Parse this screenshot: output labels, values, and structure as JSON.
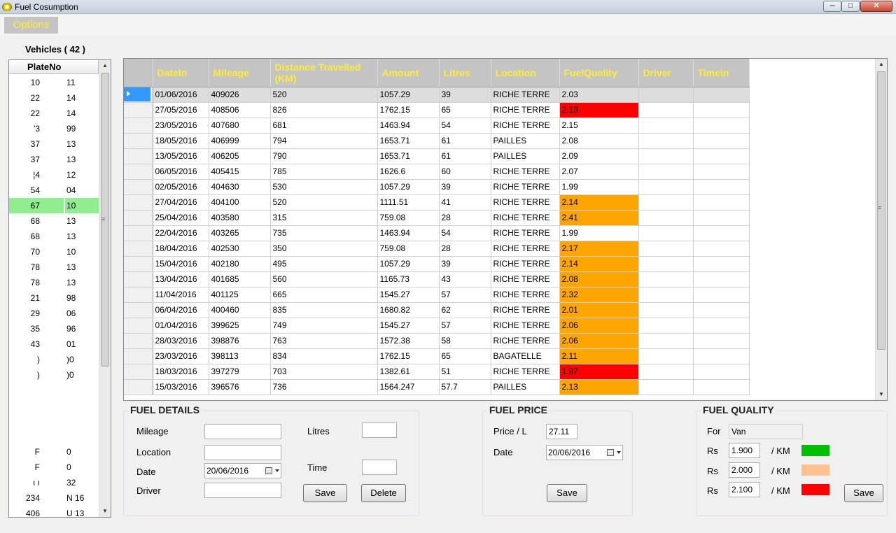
{
  "window": {
    "title": "Fuel Cosumption"
  },
  "menu": {
    "options_label": "Options"
  },
  "vehicles": {
    "title": "Vehicles ( 42 )",
    "column": "PlateNo",
    "rows_top": [
      {
        "a": "10",
        "b": "11"
      },
      {
        "a": "22",
        "b": "14"
      },
      {
        "a": "22",
        "b": "14"
      },
      {
        "a": "3'",
        "b": "99"
      },
      {
        "a": "37",
        "b": "13"
      },
      {
        "a": "37",
        "b": "13"
      },
      {
        "a": "4¦",
        "b": "12"
      },
      {
        "a": "54",
        "b": "04"
      },
      {
        "a": "67",
        "b": "10"
      },
      {
        "a": "68",
        "b": "13"
      },
      {
        "a": "68",
        "b": "13"
      },
      {
        "a": "70",
        "b": "10"
      },
      {
        "a": "78",
        "b": "13"
      },
      {
        "a": "78",
        "b": "13"
      },
      {
        "a": "21",
        "b": "98"
      },
      {
        "a": "29",
        "b": "06"
      },
      {
        "a": "35",
        "b": "96"
      },
      {
        "a": "43",
        "b": "01"
      },
      {
        "a": "(",
        "b": ")0"
      },
      {
        "a": "(",
        "b": ")0"
      }
    ],
    "rows_bottom": [
      {
        "a": "F",
        "b": "0"
      },
      {
        "a": "F",
        "b": "0"
      },
      {
        "a": "ı ı",
        "b": "32"
      },
      {
        "a": "234",
        "b": "N 16"
      },
      {
        "a": "406",
        "b": "U 13"
      }
    ],
    "selected_index": 8
  },
  "grid": {
    "columns": [
      "DateIn",
      "Mileage",
      "Distance Travelled (KM)",
      "Amount",
      "Litres",
      "Location",
      "FuelQuality",
      "Driver",
      "TimeIn"
    ],
    "rows": [
      {
        "date": "01/06/2016",
        "mileage": "409026",
        "distance": "520",
        "amount": "1057.29",
        "litres": "39",
        "location": "RICHE TERRE",
        "quality": "2.03",
        "q": ""
      },
      {
        "date": "27/05/2016",
        "mileage": "408506",
        "distance": "826",
        "amount": "1762.15",
        "litres": "65",
        "location": "RICHE TERRE",
        "quality": "2.13",
        "q": "red"
      },
      {
        "date": "23/05/2016",
        "mileage": "407680",
        "distance": "681",
        "amount": "1463.94",
        "litres": "54",
        "location": "RICHE TERRE",
        "quality": "2.15",
        "q": ""
      },
      {
        "date": "18/05/2016",
        "mileage": "406999",
        "distance": "794",
        "amount": "1653.71",
        "litres": "61",
        "location": "PAILLES",
        "quality": "2.08",
        "q": ""
      },
      {
        "date": "13/05/2016",
        "mileage": "406205",
        "distance": "790",
        "amount": "1653.71",
        "litres": "61",
        "location": "PAILLES",
        "quality": "2.09",
        "q": ""
      },
      {
        "date": "06/05/2016",
        "mileage": "405415",
        "distance": "785",
        "amount": "1626.6",
        "litres": "60",
        "location": "RICHE TERRE",
        "quality": "2.07",
        "q": ""
      },
      {
        "date": "02/05/2016",
        "mileage": "404630",
        "distance": "530",
        "amount": "1057.29",
        "litres": "39",
        "location": "RICHE TERRE",
        "quality": "1.99",
        "q": ""
      },
      {
        "date": "27/04/2016",
        "mileage": "404100",
        "distance": "520",
        "amount": "1111.51",
        "litres": "41",
        "location": "RICHE TERRE",
        "quality": "2.14",
        "q": "orange"
      },
      {
        "date": "25/04/2016",
        "mileage": "403580",
        "distance": "315",
        "amount": "759.08",
        "litres": "28",
        "location": "RICHE TERRE",
        "quality": "2.41",
        "q": "orange"
      },
      {
        "date": "22/04/2016",
        "mileage": "403265",
        "distance": "735",
        "amount": "1463.94",
        "litres": "54",
        "location": "RICHE TERRE",
        "quality": "1.99",
        "q": ""
      },
      {
        "date": "18/04/2016",
        "mileage": "402530",
        "distance": "350",
        "amount": "759.08",
        "litres": "28",
        "location": "RICHE TERRE",
        "quality": "2.17",
        "q": "orange"
      },
      {
        "date": "15/04/2016",
        "mileage": "402180",
        "distance": "495",
        "amount": "1057.29",
        "litres": "39",
        "location": "RICHE TERRE",
        "quality": "2.14",
        "q": "orange"
      },
      {
        "date": "13/04/2016",
        "mileage": "401685",
        "distance": "560",
        "amount": "1165.73",
        "litres": "43",
        "location": "RICHE TERRE",
        "quality": "2.08",
        "q": "orange"
      },
      {
        "date": "11/04/2016",
        "mileage": "401125",
        "distance": "665",
        "amount": "1545.27",
        "litres": "57",
        "location": "RICHE TERRE",
        "quality": "2.32",
        "q": "orange"
      },
      {
        "date": "06/04/2016",
        "mileage": "400460",
        "distance": "835",
        "amount": "1680.82",
        "litres": "62",
        "location": "RICHE TERRE",
        "quality": "2.01",
        "q": "orange"
      },
      {
        "date": "01/04/2016",
        "mileage": "399625",
        "distance": "749",
        "amount": "1545.27",
        "litres": "57",
        "location": "RICHE TERRE",
        "quality": "2.06",
        "q": "orange"
      },
      {
        "date": "28/03/2016",
        "mileage": "398876",
        "distance": "763",
        "amount": "1572.38",
        "litres": "58",
        "location": "RICHE TERRE",
        "quality": "2.06",
        "q": "orange"
      },
      {
        "date": "23/03/2016",
        "mileage": "398113",
        "distance": "834",
        "amount": "1762.15",
        "litres": "65",
        "location": "BAGATELLE",
        "quality": "2.11",
        "q": "orange"
      },
      {
        "date": "18/03/2016",
        "mileage": "397279",
        "distance": "703",
        "amount": "1382.61",
        "litres": "51",
        "location": "RICHE TERRE",
        "quality": "1.97",
        "q": "red"
      },
      {
        "date": "15/03/2016",
        "mileage": "396576",
        "distance": "736",
        "amount": "1564.247",
        "litres": "57.7",
        "location": "PAILLES",
        "quality": "2.13",
        "q": "orange"
      }
    ]
  },
  "fuel_details": {
    "title": "FUEL DETAILS",
    "mileage_label": "Mileage",
    "mileage_value": "",
    "location_label": "Location",
    "location_value": "",
    "date_label": "Date",
    "date_value": "20/06/2016",
    "driver_label": "Driver",
    "driver_value": "",
    "litres_label": "Litres",
    "litres_value": "",
    "time_label": "Time",
    "time_value": "",
    "save_label": "Save",
    "delete_label": "Delete"
  },
  "fuel_price": {
    "title": "FUEL PRICE",
    "price_label": "Price / L",
    "price_value": "27.11",
    "date_label": "Date",
    "date_value": "20/06/2016",
    "save_label": "Save"
  },
  "fuel_quality": {
    "title": "FUEL QUALITY",
    "for_label": "For",
    "for_value": "Van",
    "currency": "Rs",
    "unit": "/ KM",
    "levels": [
      {
        "value": "1.900",
        "color": "#00c000"
      },
      {
        "value": "2.000",
        "color": "#ffc090"
      },
      {
        "value": "2.100",
        "color": "#ff0000"
      }
    ],
    "save_label": "Save"
  }
}
